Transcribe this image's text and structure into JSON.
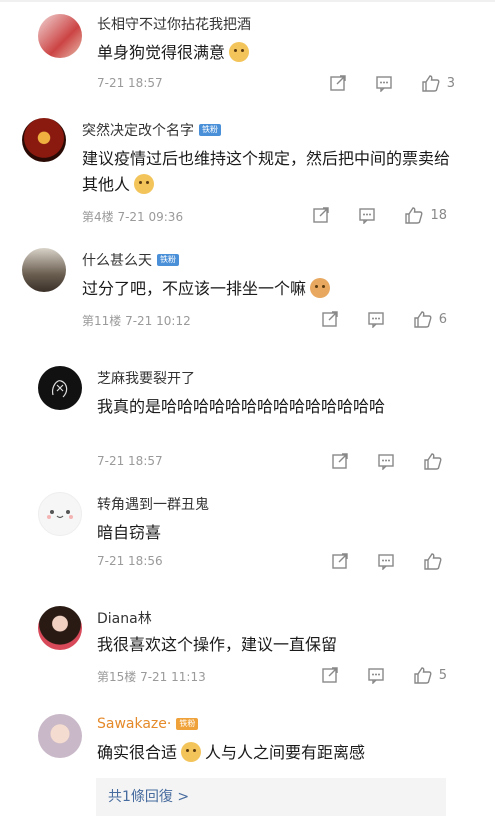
{
  "comments": [
    {
      "user": "长相守不过你拈花我把酒",
      "badge": "",
      "text": "单身狗觉得很满意",
      "emoji": "doge",
      "meta": "7-21 18:57",
      "likes": "3"
    },
    {
      "user": "突然决定改个名字",
      "badge": "铁粉",
      "text": "建议疫情过后也维持这个规定，然后把中间的票卖给其他人",
      "emoji": "doge",
      "meta": "第4楼 7-21 09:36",
      "likes": "18"
    },
    {
      "user": "什么甚么天",
      "badge": "铁粉",
      "text": "过分了吧，不应该一排坐一个嘛",
      "emoji": "cat",
      "meta": "第11楼 7-21 10:12",
      "likes": "6"
    },
    {
      "user": "芝麻我要裂开了",
      "badge": "",
      "text": "我真的是哈哈哈哈哈哈哈哈哈哈哈哈哈哈",
      "emoji": "",
      "meta": "7-21 18:57",
      "likes": ""
    },
    {
      "user": "转角遇到一群丑鬼",
      "badge": "",
      "text": "暗自窃喜",
      "emoji": "",
      "meta": "7-21 18:56",
      "likes": ""
    },
    {
      "user": "Diana林",
      "badge": "",
      "text": "我很喜欢这个操作，建议一直保留",
      "emoji": "",
      "meta": "第15楼 7-21 11:13",
      "likes": "5"
    },
    {
      "user": "Sawakaze·",
      "badge": "铁粉",
      "text_before": "确实很合适",
      "text_after": "人与人之间要有距离感",
      "emoji": "doge",
      "meta": "",
      "likes": ""
    }
  ],
  "replies_link": "共1條回復 >",
  "colors": {
    "accent_name": "#e58a2a",
    "link": "#466b9e",
    "badge": "#4a90d9"
  }
}
